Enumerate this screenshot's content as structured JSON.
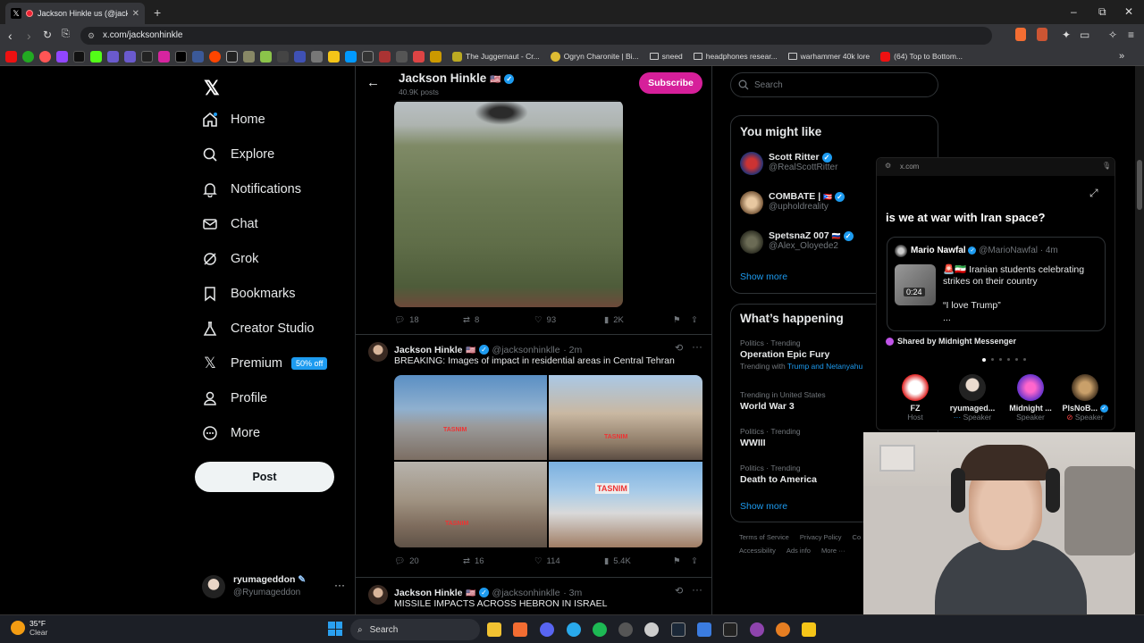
{
  "browser": {
    "tab_title": "Jackson Hinkle us (@jacksonhi",
    "url": "x.com/jacksonhinkle",
    "bookmarks": [
      "The Juggernaut - Cr...",
      "Ogryn Charonite | Bi...",
      "sneed",
      "headphones resear...",
      "warhammer 40k lore",
      "(64) Top to Bottom..."
    ]
  },
  "nav": {
    "items": [
      "Home",
      "Explore",
      "Notifications",
      "Chat",
      "Grok",
      "Bookmarks",
      "Creator Studio",
      "Premium",
      "Profile",
      "More"
    ],
    "premium_badge": "50% off",
    "post_label": "Post",
    "account_name": "ryumageddon",
    "account_handle": "@Ryumageddon"
  },
  "profile": {
    "name": "Jackson Hinkle",
    "posts_count": "40.9K posts",
    "subscribe_label": "Subscribe"
  },
  "tweets": [
    {
      "replies": "18",
      "reposts": "8",
      "likes": "93",
      "views": "2K"
    },
    {
      "name": "Jackson Hinkle",
      "handle": "@jacksonhinklle",
      "time": "· 2m",
      "text": "BREAKING: Images of impact in residential areas in Central Tehran",
      "watermark": "TASNIM",
      "replies": "20",
      "reposts": "16",
      "likes": "114",
      "views": "5.4K"
    },
    {
      "name": "Jackson Hinkle",
      "handle": "@jacksonhinklle",
      "time": "· 3m",
      "text": "MISSILE IMPACTS ACROSS HEBRON IN ISRAEL"
    }
  ],
  "sidebar": {
    "search_placeholder": "Search",
    "might_like_title": "You might like",
    "suggestions": [
      {
        "name": "Scott Ritter",
        "handle": "@RealScottRitter"
      },
      {
        "name": "COMBATE |",
        "handle": "@upholdreality"
      },
      {
        "name": "SpetsnaZ 007",
        "handle": "@Alex_Oloyede2"
      }
    ],
    "show_more": "Show more",
    "happening_title": "What’s happening",
    "trends": [
      {
        "meta": "Politics · Trending",
        "title": "Operation Epic Fury",
        "sub_prefix": "Trending with",
        "sub_links": "Trump and Netanyahu"
      },
      {
        "meta": "Trending in United States",
        "title": "World War 3"
      },
      {
        "meta": "Politics · Trending",
        "title": "WWIII"
      },
      {
        "meta": "Politics · Trending",
        "title": "Death to America"
      }
    ],
    "footer": [
      "Terms of Service",
      "Privacy Policy",
      "Co",
      "Accessibility",
      "Ads info",
      "More ···"
    ]
  },
  "overlay": {
    "site": "x.com",
    "question": "is we at war with Iran space?",
    "quote_name": "Mario Nawfal",
    "quote_handle": "@MarioNawfal · 4m",
    "quote_text": "Iranian students celebrating strikes on their country",
    "quote_text2": "“I love Trump”",
    "quote_more": "...",
    "video_time": "0:24",
    "shared_by": "Shared by Midnight Messenger",
    "speakers": [
      {
        "name": "FZ",
        "role": "Host"
      },
      {
        "name": "ryumaged...",
        "role": "Speaker"
      },
      {
        "name": "Midnight ...",
        "role": "Speaker"
      },
      {
        "name": "PlsNoB...",
        "role": "Speaker"
      }
    ]
  },
  "taskbar": {
    "weather_temp": "35°F",
    "weather_desc": "Clear",
    "search_label": "Search"
  },
  "colors": {
    "accent": "#1d9bf0",
    "subscribe": "#d61f9a"
  }
}
